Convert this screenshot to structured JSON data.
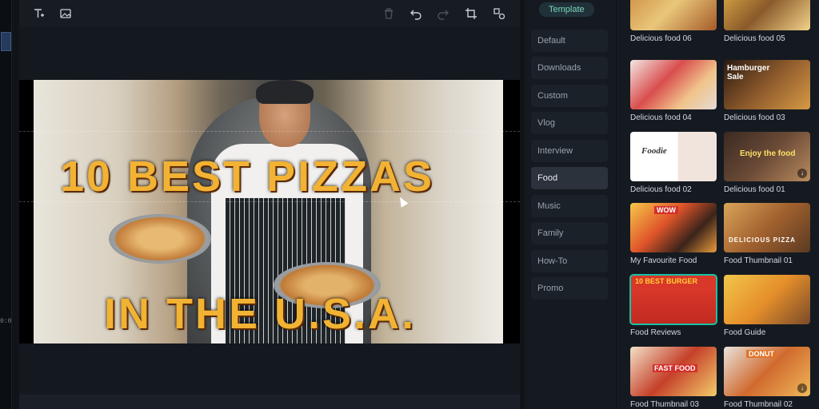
{
  "timecode": "0:0",
  "side_tab": "Template",
  "categories": [
    "Default",
    "Downloads",
    "Custom",
    "Vlog",
    "Interview",
    "Food",
    "Music",
    "Family",
    "How-To",
    "Promo"
  ],
  "active_category": "Food",
  "headline": {
    "line1": "10 BEST PIZZAS",
    "line2": "IN THE U.S.A."
  },
  "templates": [
    {
      "name": "Delicious food 06"
    },
    {
      "name": "Delicious food 05"
    },
    {
      "name": "Delicious food 04"
    },
    {
      "name": "Delicious food 03",
      "thumb_text": "Hamburger Sale"
    },
    {
      "name": "Delicious food 02",
      "thumb_text": "Foodie"
    },
    {
      "name": "Delicious food 01",
      "thumb_text": "Enjoy the food"
    },
    {
      "name": "My Favourite Food",
      "thumb_text": "WOW"
    },
    {
      "name": "Food Thumbnail 01",
      "thumb_text": "DELICIOUS PIZZA"
    },
    {
      "name": "Food Reviews",
      "thumb_text": "10 BEST BURGER"
    },
    {
      "name": "Food Guide"
    },
    {
      "name": "Food Thumbnail 03",
      "thumb_text": "FAST FOOD"
    },
    {
      "name": "Food Thumbnail 02",
      "thumb_text": "DONUT"
    }
  ],
  "colors": {
    "accent": "#19c2a4",
    "headline": "#f2b233",
    "panel_bg": "#151a21"
  }
}
